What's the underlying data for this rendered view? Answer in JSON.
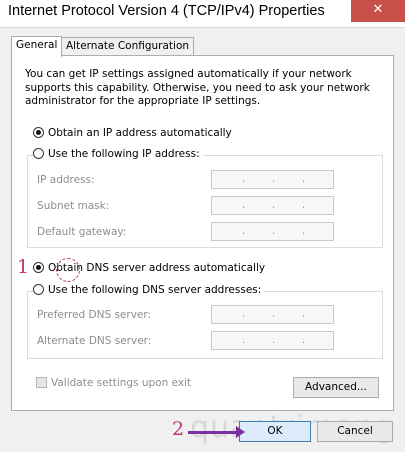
{
  "window": {
    "title": "Internet Protocol Version 4 (TCP/IPv4) Properties",
    "close_glyph": "✕"
  },
  "tabs": [
    {
      "label": "General",
      "active": true
    },
    {
      "label": "Alternate Configuration",
      "active": false
    }
  ],
  "description": "You can get IP settings assigned automatically if your network supports this capability. Otherwise, you need to ask your network administrator for the appropriate IP settings.",
  "ip_section": {
    "auto_label": "Obtain an IP address automatically",
    "auto_selected": true,
    "manual_label": "Use the following IP address:",
    "fields": [
      {
        "label": "IP address:"
      },
      {
        "label": "Subnet mask:"
      },
      {
        "label": "Default gateway:"
      }
    ]
  },
  "dns_section": {
    "auto_label": "Obtain DNS server address automatically",
    "auto_selected": true,
    "manual_label": "Use the following DNS server addresses:",
    "fields": [
      {
        "label": "Preferred DNS server:"
      },
      {
        "label": "Alternate DNS server:"
      }
    ]
  },
  "ip_dot": ".",
  "validate_label": "Validate settings upon exit",
  "buttons": {
    "advanced": "Advanced...",
    "ok": "OK",
    "cancel": "Cancel"
  },
  "annotations": {
    "step1": "1",
    "step2": "2"
  },
  "colors": {
    "close_red": "#c7504a",
    "annotation": "#c0396d",
    "arrow": "#7b2fa0"
  }
}
